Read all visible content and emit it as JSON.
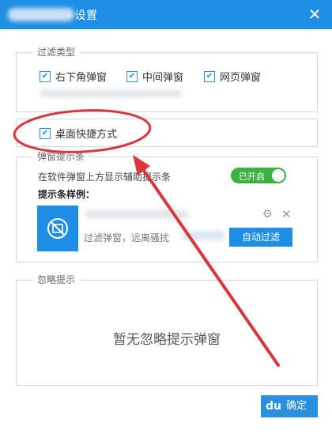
{
  "window": {
    "title": "- 设置",
    "close_glyph": "✕"
  },
  "filter_type": {
    "legend": "过滤类型",
    "options": [
      {
        "label": "右下角弹窗",
        "checked": true
      },
      {
        "label": "中间弹窗",
        "checked": true
      },
      {
        "label": "网页弹窗",
        "checked": true
      }
    ]
  },
  "desktop_shortcut": {
    "label": "桌面快捷方式",
    "checked": true
  },
  "popup_hint": {
    "legend": "弹窗提示条",
    "description": "在软件弹窗上方显示辅助提示条",
    "toggle_label": "已开启",
    "toggle_on": true,
    "sample_label": "提示条样例：",
    "sample_desc": "过滤弹窗，远离骚扰",
    "auto_filter_button": "自动过滤",
    "gear_glyph": "⚙",
    "close_glyph": "✕"
  },
  "ignore_hint": {
    "legend": "忽略提示",
    "empty_text": "暂无忽略提示弹窗"
  },
  "footer": {
    "ok_button": "确定",
    "watermark": "du"
  },
  "colors": {
    "accent": "#1f8ee5",
    "toggle_on": "#3cb043",
    "annotation": "#d9363e"
  }
}
